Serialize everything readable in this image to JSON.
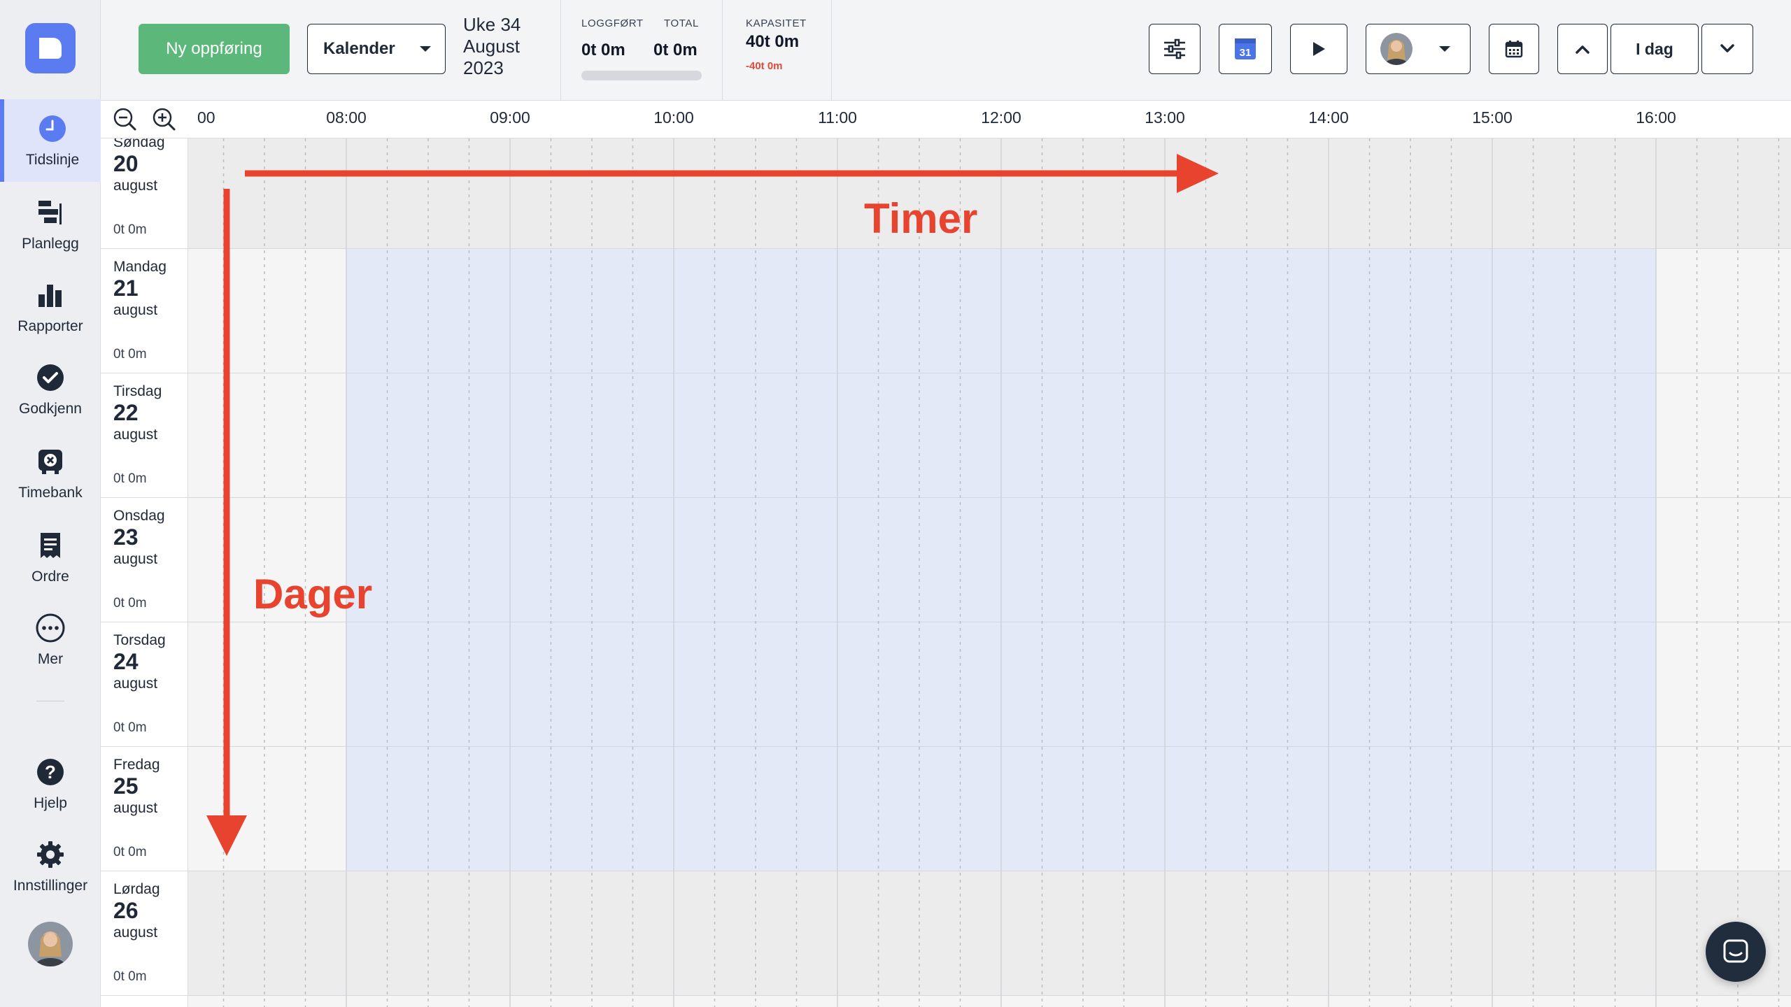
{
  "sidebar": {
    "items": [
      {
        "label": "Tidslinje",
        "icon": "clock-icon",
        "active": true
      },
      {
        "label": "Planlegg",
        "icon": "schedule-icon"
      },
      {
        "label": "Rapporter",
        "icon": "bar-chart-icon"
      },
      {
        "label": "Godkjenn",
        "icon": "check-circle-icon"
      },
      {
        "label": "Timebank",
        "icon": "timebank-icon"
      },
      {
        "label": "Ordre",
        "icon": "receipt-icon"
      },
      {
        "label": "Mer",
        "icon": "more-icon"
      }
    ],
    "bottom_items": [
      {
        "label": "Hjelp",
        "icon": "help-icon"
      },
      {
        "label": "Innstillinger",
        "icon": "gear-icon"
      }
    ]
  },
  "toolbar": {
    "new_entry_label": "Ny oppføring",
    "view_select_value": "Kalender",
    "week_label": "Uke 34",
    "month_label": "August",
    "year_label": "2023",
    "logged_label": "LOGGFØRT",
    "logged_value": "0t 0m",
    "total_label": "TOTAL",
    "total_value": "0t 0m",
    "logged_progress": 0,
    "capacity_label": "KAPASITET",
    "capacity_value": "40t 0m",
    "capacity_diff": "-40t 0m",
    "google_calendar_day": "31",
    "today_label": "I dag"
  },
  "timeline": {
    "hours": [
      "08:00",
      "09:00",
      "10:00",
      "11:00",
      "12:00",
      "13:00",
      "14:00",
      "15:00",
      "16:00"
    ],
    "partial_hour": "00",
    "days": [
      {
        "name": "Søndag",
        "num": "20",
        "month": "august",
        "hours": "0t 0m",
        "weekend": true
      },
      {
        "name": "Mandag",
        "num": "21",
        "month": "august",
        "hours": "0t 0m",
        "weekend": false
      },
      {
        "name": "Tirsdag",
        "num": "22",
        "month": "august",
        "hours": "0t 0m",
        "weekend": false
      },
      {
        "name": "Onsdag",
        "num": "23",
        "month": "august",
        "hours": "0t 0m",
        "weekend": false
      },
      {
        "name": "Torsdag",
        "num": "24",
        "month": "august",
        "hours": "0t 0m",
        "weekend": false
      },
      {
        "name": "Fredag",
        "num": "25",
        "month": "august",
        "hours": "0t 0m",
        "weekend": false
      },
      {
        "name": "Lørdag",
        "num": "26",
        "month": "august",
        "hours": "0t 0m",
        "weekend": true
      }
    ]
  },
  "annotations": {
    "horizontal_label": "Timer",
    "vertical_label": "Dager"
  },
  "colors": {
    "accent": "#5b7cf0",
    "primary_button": "#5cb87a",
    "annotation": "#e8432f",
    "workday_band": "#e4e9f8"
  }
}
